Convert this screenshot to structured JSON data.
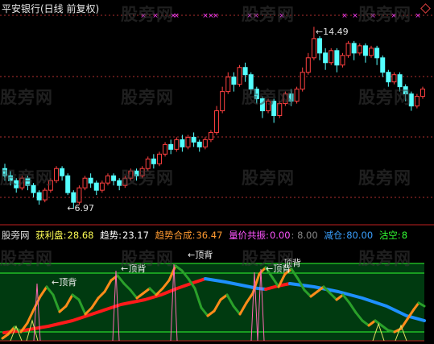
{
  "header": {
    "title": "平安银行(日线 前复权)"
  },
  "indicator_bar": {
    "name": "股旁网",
    "profit_label": "获利盘:",
    "profit_value": "28.68",
    "trend_label": "趋势:",
    "trend_value": "23.17",
    "trend_combined_label": "趋势合成:",
    "trend_combined_value": "36.47",
    "resonance_label": "量价共振:",
    "resonance_value": "0.00",
    "resonance_value2": ": 8.00",
    "reduce_label": "减仓:",
    "reduce_value": "80.00",
    "empty_label": "沽空:",
    "empty_value": "8"
  },
  "watermark": "股旁网",
  "colors": {
    "background": "#000000",
    "up_candle": "#ff4040",
    "down_candle": "#54ffff",
    "grid": "#b03030",
    "marker": "#ff40ff",
    "lower_panel_bg": "#003a10",
    "lower_panel_lines": "#2fff2f",
    "curve_green": "#2aa02a",
    "curve_orange": "#ff8c1a",
    "curve_red": "#ff1a1a",
    "curve_blue": "#1e90ff",
    "pink_spike": "#ff69b4",
    "yellow_curve": "#e0e060"
  },
  "chart_data": [
    {
      "type": "candlestick",
      "title": "平安银行(日线 前复权)",
      "annotations": [
        {
          "text": "←14.49",
          "kind": "high"
        },
        {
          "text": "←6.97",
          "kind": "low"
        }
      ],
      "marker_symbol": "×",
      "price_high": 14.49,
      "price_low": 6.97,
      "candles": [
        [
          8.6,
          8.3,
          8.8,
          8.1
        ],
        [
          8.3,
          8.1,
          8.5,
          7.9
        ],
        [
          8.1,
          7.8,
          8.2,
          7.6
        ],
        [
          7.8,
          8.2,
          8.3,
          7.7
        ],
        [
          8.2,
          7.9,
          8.3,
          7.7
        ],
        [
          7.9,
          7.6,
          8.0,
          7.4
        ],
        [
          7.6,
          7.3,
          7.7,
          7.1
        ],
        [
          7.3,
          7.7,
          7.8,
          7.2
        ],
        [
          7.7,
          8.1,
          8.2,
          7.6
        ],
        [
          8.1,
          8.6,
          8.7,
          8.0
        ],
        [
          8.6,
          8.3,
          8.7,
          8.1
        ],
        [
          8.3,
          7.6,
          8.4,
          7.5
        ],
        [
          7.6,
          7.2,
          7.7,
          6.97
        ],
        [
          7.2,
          7.8,
          7.9,
          7.1
        ],
        [
          7.8,
          8.2,
          8.3,
          7.7
        ],
        [
          8.2,
          8.0,
          8.4,
          7.8
        ],
        [
          8.0,
          7.7,
          8.1,
          7.5
        ],
        [
          7.7,
          8.0,
          8.1,
          7.6
        ],
        [
          8.0,
          8.3,
          8.4,
          7.9
        ],
        [
          8.3,
          8.1,
          8.4,
          7.9
        ],
        [
          8.1,
          7.9,
          8.2,
          7.7
        ],
        [
          7.9,
          8.2,
          8.3,
          7.8
        ],
        [
          8.2,
          8.5,
          8.6,
          8.1
        ],
        [
          8.5,
          8.3,
          8.6,
          8.1
        ],
        [
          8.3,
          8.6,
          8.7,
          8.2
        ],
        [
          8.6,
          9.0,
          9.1,
          8.5
        ],
        [
          9.0,
          8.8,
          9.2,
          8.6
        ],
        [
          8.8,
          9.2,
          9.3,
          8.7
        ],
        [
          9.2,
          9.6,
          9.7,
          9.1
        ],
        [
          9.6,
          9.4,
          9.8,
          9.2
        ],
        [
          9.4,
          9.8,
          9.9,
          9.3
        ],
        [
          9.8,
          9.5,
          10.0,
          9.3
        ],
        [
          9.5,
          9.9,
          10.0,
          9.4
        ],
        [
          9.9,
          9.7,
          10.1,
          9.5
        ],
        [
          9.7,
          9.5,
          9.8,
          9.3
        ],
        [
          9.5,
          9.8,
          9.9,
          9.4
        ],
        [
          9.8,
          10.1,
          10.2,
          9.7
        ],
        [
          10.1,
          11.0,
          11.2,
          10.0
        ],
        [
          11.0,
          11.8,
          12.0,
          10.9
        ],
        [
          11.8,
          12.4,
          12.6,
          11.7
        ],
        [
          12.4,
          12.1,
          12.6,
          11.8
        ],
        [
          12.1,
          12.8,
          12.9,
          12.0
        ],
        [
          12.8,
          12.5,
          13.0,
          12.2
        ],
        [
          12.5,
          11.9,
          12.6,
          11.7
        ],
        [
          11.9,
          11.5,
          12.0,
          11.3
        ],
        [
          11.5,
          11.0,
          11.6,
          10.7
        ],
        [
          11.0,
          11.4,
          11.5,
          10.9
        ],
        [
          11.4,
          10.8,
          11.5,
          10.5
        ],
        [
          10.8,
          11.3,
          11.4,
          10.7
        ],
        [
          11.3,
          11.7,
          11.8,
          11.2
        ],
        [
          11.7,
          11.4,
          11.9,
          11.2
        ],
        [
          11.4,
          11.9,
          12.0,
          11.3
        ],
        [
          11.9,
          12.6,
          12.8,
          11.8
        ],
        [
          12.6,
          13.2,
          13.4,
          12.5
        ],
        [
          13.2,
          14.0,
          14.49,
          13.1
        ],
        [
          14.0,
          13.4,
          14.1,
          13.1
        ],
        [
          13.4,
          13.0,
          13.6,
          12.7
        ],
        [
          13.0,
          13.5,
          13.6,
          12.9
        ],
        [
          13.5,
          12.9,
          13.6,
          12.6
        ],
        [
          12.9,
          13.3,
          13.4,
          12.8
        ],
        [
          13.3,
          13.8,
          13.9,
          13.2
        ],
        [
          13.8,
          13.4,
          13.9,
          13.1
        ],
        [
          13.4,
          13.7,
          13.8,
          13.3
        ],
        [
          13.7,
          13.3,
          13.8,
          13.0
        ],
        [
          13.3,
          13.6,
          13.7,
          13.2
        ],
        [
          13.6,
          13.2,
          13.7,
          12.9
        ],
        [
          13.2,
          12.6,
          13.3,
          12.4
        ],
        [
          12.6,
          12.2,
          12.7,
          12.0
        ],
        [
          12.2,
          12.5,
          12.6,
          12.1
        ],
        [
          12.5,
          12.0,
          12.6,
          11.8
        ],
        [
          12.0,
          11.7,
          12.1,
          11.4
        ],
        [
          11.7,
          11.2,
          11.8,
          11.0
        ],
        [
          11.2,
          11.6,
          11.7,
          11.1
        ],
        [
          11.6,
          11.9,
          12.0,
          11.5
        ]
      ]
    },
    {
      "type": "line",
      "title": "股旁网",
      "series": [
        {
          "name": "获利盘",
          "values": [
            28.68
          ]
        },
        {
          "name": "趋势",
          "values": [
            23.17
          ]
        },
        {
          "name": "趋势合成",
          "values": [
            36.47
          ]
        },
        {
          "name": "量价共振",
          "values": [
            0.0,
            8.0
          ]
        },
        {
          "name": "减仓",
          "values": [
            80.0
          ]
        },
        {
          "name": "沽空",
          "values": [
            8
          ]
        }
      ],
      "annotations": [
        "←顶背",
        "←顶背",
        "←顶背",
        "←顶背",
        "顶背"
      ]
    }
  ]
}
